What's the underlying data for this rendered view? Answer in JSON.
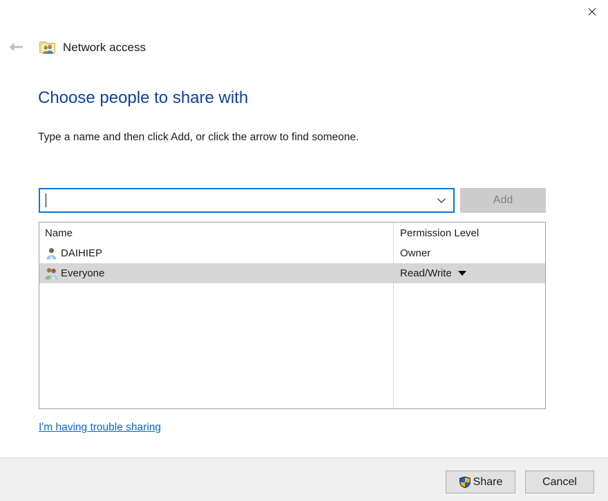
{
  "window": {
    "title": "Network access",
    "close_label": "✕",
    "back_label": "Back",
    "folder_icon": "shared-folder-people-icon"
  },
  "content": {
    "heading": "Choose people to share with",
    "subtext": "Type a name and then click Add, or click the arrow to find someone.",
    "heading_color": "#11419b"
  },
  "entry": {
    "combo_value": "",
    "combo_placeholder": "",
    "combo_arrow_icon": "chevron-down-icon",
    "add_label": "Add",
    "add_enabled": false
  },
  "list": {
    "columns": [
      "Name",
      "Permission Level"
    ],
    "rows": [
      {
        "name": "DAIHIEP",
        "permission": "Owner",
        "icon": "single-user-icon",
        "selected": false,
        "has_dropdown": false
      },
      {
        "name": "Everyone",
        "permission": "Read/Write",
        "icon": "group-users-icon",
        "selected": true,
        "has_dropdown": true
      }
    ],
    "selection_color": "#d6d6d6"
  },
  "links": {
    "trouble": "I'm having trouble sharing",
    "link_color": "#0a64c8"
  },
  "footer": {
    "share_label": "Share",
    "cancel_label": "Cancel",
    "share_icon": "uac-shield-icon"
  }
}
